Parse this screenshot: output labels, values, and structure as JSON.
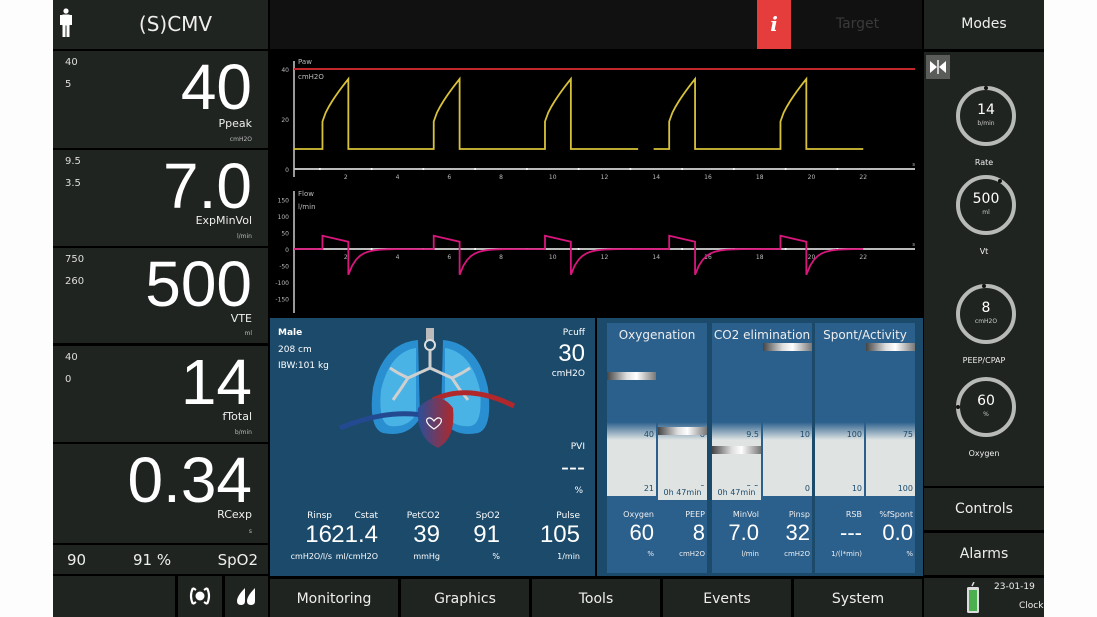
{
  "mode": {
    "label": "(S)CMV",
    "icon": "adult-patient-icon"
  },
  "main_monitoring": [
    {
      "name": "Ppeak",
      "value": "40",
      "unit": "cmH2O",
      "alarm_high": "40",
      "alarm_low": "5"
    },
    {
      "name": "ExpMinVol",
      "value": "7.0",
      "unit": "l/min",
      "alarm_high": "9.5",
      "alarm_low": "3.5"
    },
    {
      "name": "VTE",
      "value": "500",
      "unit": "ml",
      "alarm_high": "750",
      "alarm_low": "260"
    },
    {
      "name": "fTotal",
      "value": "14",
      "unit": "b/min",
      "alarm_high": "40",
      "alarm_low": "0"
    },
    {
      "name": "RCexp",
      "value": "0.34",
      "unit": "s",
      "alarm_high": "",
      "alarm_low": ""
    }
  ],
  "spo2_row": {
    "limit": "90",
    "value": "91 %",
    "label": "SpO2"
  },
  "left_icons": [
    "pressure-sensor-icon",
    "nebulizer-icon"
  ],
  "topbar": {
    "info_icon": "i",
    "target_label": "Target"
  },
  "waveforms": {
    "paw": {
      "title": "Paw",
      "unit": "cmH2O",
      "y_ticks": [
        "40",
        "20",
        "0"
      ],
      "limit_line": 40,
      "color": "#d8c23a",
      "limit_color": "#c0282d"
    },
    "flow": {
      "title": "Flow",
      "unit": "l/min",
      "y_ticks": [
        "150",
        "100",
        "50",
        "0",
        "-50",
        "-100",
        "-150"
      ],
      "color": "#d8167c"
    },
    "x_ticks": [
      "2",
      "4",
      "6",
      "8",
      "10",
      "12",
      "14",
      "16",
      "18",
      "20",
      "22"
    ],
    "x_unit": "s",
    "breath_starts": [
      1.1,
      5.4,
      9.7,
      14.5,
      18.8
    ],
    "insp_time": 1.0,
    "peep": 8,
    "ppeak": 36
  },
  "lung_panel": {
    "sex": "Male",
    "height": "208  cm",
    "ibw": "IBW:101  kg",
    "pcuff": {
      "label": "Pcuff",
      "value": "30",
      "unit": "cmH2O"
    },
    "pvi": {
      "label": "PVI",
      "value": "---",
      "unit": "%"
    },
    "params": [
      {
        "label": "Rinsp",
        "value": "16",
        "unit": "cmH2O/l/s"
      },
      {
        "label": "Cstat",
        "value": "21.4",
        "unit": "ml/cmH2O"
      },
      {
        "label": "PetCO2",
        "value": "39",
        "unit": "mmHg"
      },
      {
        "label": "SpO2",
        "value": "91",
        "unit": "%"
      },
      {
        "label": "Pulse",
        "value": "105",
        "unit": "1/min"
      }
    ]
  },
  "vent_status": {
    "groups": [
      {
        "title": "Oxygenation"
      },
      {
        "title": "CO2 elimination"
      },
      {
        "title": "Spont/Activity"
      }
    ],
    "bars": [
      {
        "label": "Oxygen",
        "value": "60",
        "unit": "%",
        "top": "40",
        "bottom": "21",
        "marker_level": 0.78,
        "timer": ""
      },
      {
        "label": "PEEP",
        "value": "8",
        "unit": "cmH2O",
        "top": "8",
        "bottom": "0",
        "marker_level": 0.42,
        "timer": "0h 47min"
      },
      {
        "label": "MinVol",
        "value": "7.0",
        "unit": "l/min",
        "top": "9.5",
        "bottom": "3.5",
        "marker_level": 0.3,
        "timer": "0h 47min"
      },
      {
        "label": "Pinsp",
        "value": "32",
        "unit": "cmH2O",
        "top": "10",
        "bottom": "0",
        "marker_level": 0.97,
        "timer": ""
      },
      {
        "label": "RSB",
        "value": "---",
        "unit": "1/(l*min)",
        "top": "100",
        "bottom": "10",
        "marker_level": null,
        "timer": ""
      },
      {
        "label": "%fSpont",
        "value": "0.0",
        "unit": "%",
        "top": "75",
        "bottom": "100",
        "marker_level": 0.97,
        "timer": ""
      }
    ]
  },
  "right_panel": {
    "modes_label": "Modes",
    "freeze_icon": "freeze-icon",
    "controls": [
      {
        "label": "Rate",
        "value": "14",
        "unit": "b/min"
      },
      {
        "label": "Vt",
        "value": "500",
        "unit": "ml"
      },
      {
        "label": "PEEP/CPAP",
        "value": "8",
        "unit": "cmH2O"
      },
      {
        "label": "Oxygen",
        "value": "60",
        "unit": "%"
      }
    ],
    "controls_label": "Controls",
    "alarms_label": "Alarms",
    "date": "23-01-19",
    "clock_label": "Clock",
    "battery_icon": "battery-icon"
  },
  "tabs": [
    "Monitoring",
    "Graphics",
    "Tools",
    "Events",
    "System"
  ]
}
